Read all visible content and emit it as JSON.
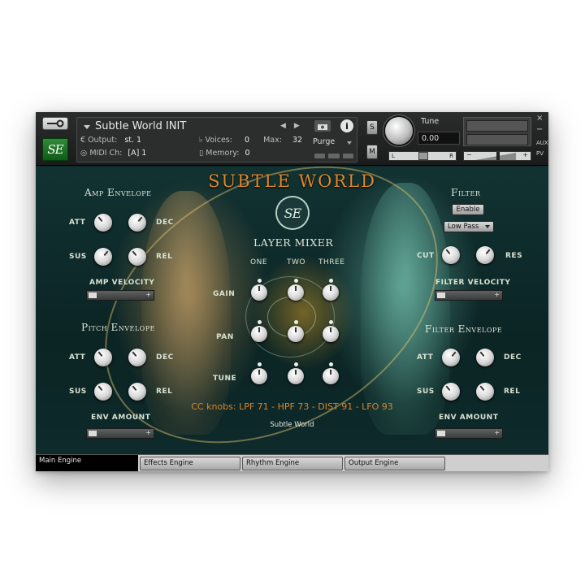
{
  "header": {
    "instrument_name": "Subtle World INIT",
    "output_label": "Output:",
    "output_value": "st. 1",
    "midi_label": "MIDI Ch:",
    "midi_value": "[A]  1",
    "voices_label": "Voices:",
    "voices_value": "0",
    "max_label": "Max:",
    "max_value": "32",
    "memory_label": "Memory:",
    "memory_value": "0",
    "purge_label": "Purge",
    "solo_label": "S",
    "mute_label": "M",
    "tune_label": "Tune",
    "tune_value": "0.00",
    "pan_left": "L",
    "pan_right": "R",
    "aux_label": "AUX",
    "pv_label": "PV",
    "close_glyph": "×",
    "min_glyph": "−"
  },
  "main": {
    "title": "SUBTLE WORLD",
    "logo_text": "SE",
    "amp_envelope": {
      "title": "Amp Envelope",
      "att": "ATT",
      "dec": "DEC",
      "sus": "SUS",
      "rel": "REL",
      "velocity_label": "AMP VELOCITY"
    },
    "pitch_envelope": {
      "title": "Pitch Envelope",
      "att": "ATT",
      "dec": "DEC",
      "sus": "SUS",
      "rel": "REL",
      "amount_label": "ENV AMOUNT"
    },
    "layer_mixer": {
      "title": "LAYER MIXER",
      "columns": [
        "ONE",
        "TWO",
        "THREE"
      ],
      "rows": [
        "GAIN",
        "PAN",
        "TUNE"
      ]
    },
    "filter": {
      "title": "Filter",
      "enable_label": "Enable",
      "type_value": "Low Pass",
      "cut": "CUT",
      "res": "RES",
      "velocity_label": "FILTER VELOCITY"
    },
    "filter_envelope": {
      "title": "Filter Envelope",
      "att": "ATT",
      "dec": "DEC",
      "sus": "SUS",
      "rel": "REL",
      "amount_label": "ENV AMOUNT"
    },
    "cc_text": "CC knobs: LPF 71 - HPF 73 - DIST 91 - LFO 93",
    "subtitle": "Subtle World"
  },
  "tabs": [
    {
      "label": "Main Engine",
      "active": true
    },
    {
      "label": "Effects Engine"
    },
    {
      "label": "Rhythm Engine"
    },
    {
      "label": "Output Engine"
    }
  ],
  "colors": {
    "title_orange": "#e0862a",
    "panel_bg": "#0d2626",
    "logo_green": "#1f7a2a"
  }
}
